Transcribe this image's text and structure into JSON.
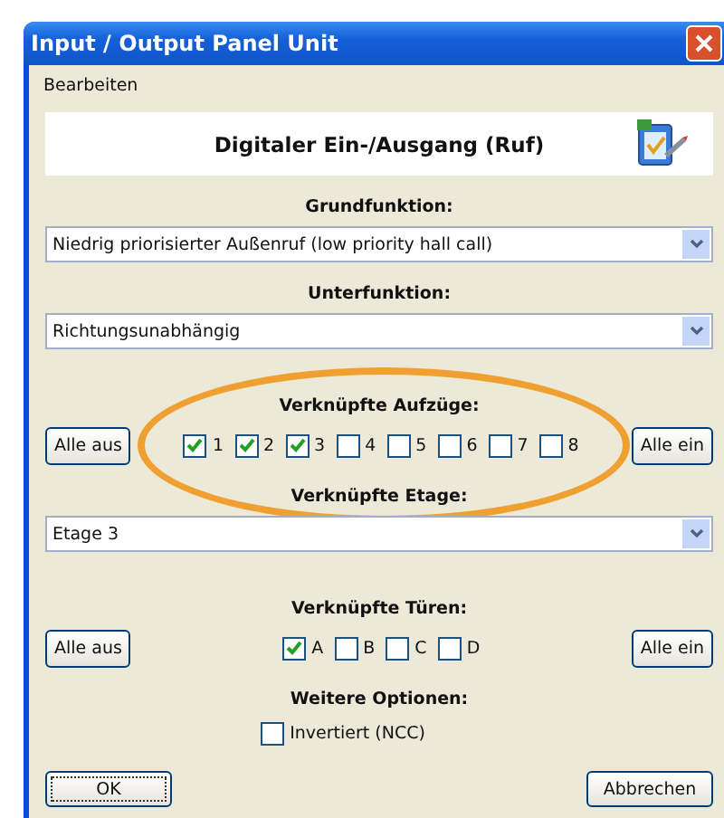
{
  "window": {
    "title": "Input / Output Panel Unit"
  },
  "menu": [
    "Bearbeiten"
  ],
  "header": {
    "title": "Digitaler Ein-/Ausgang (Ruf)"
  },
  "sections": [
    {
      "kind": "select",
      "label": "Grundfunktion:",
      "value": "Niedrig priorisierter Außenruf (low priority hall call)"
    },
    {
      "kind": "select",
      "label": "Unterfunktion:",
      "value": "Richtungsunabhängig"
    },
    {
      "kind": "checks",
      "label": "Verknüpfte Aufzüge:",
      "highlighted": true,
      "buttons": [
        "Alle aus",
        "Alle ein"
      ],
      "options": [
        {
          "label": "1",
          "checked": true
        },
        {
          "label": "2",
          "checked": true
        },
        {
          "label": "3",
          "checked": true
        },
        {
          "label": "4",
          "checked": false
        },
        {
          "label": "5",
          "checked": false
        },
        {
          "label": "6",
          "checked": false
        },
        {
          "label": "7",
          "checked": false
        },
        {
          "label": "8",
          "checked": false
        }
      ]
    },
    {
      "kind": "select",
      "label": "Verknüpfte Etage:",
      "value": "Etage 3"
    },
    {
      "kind": "checks",
      "label": "Verknüpfte Türen:",
      "buttons": [
        "Alle aus",
        "Alle ein"
      ],
      "options": [
        {
          "label": "A",
          "checked": true
        },
        {
          "label": "B",
          "checked": false
        },
        {
          "label": "C",
          "checked": false
        },
        {
          "label": "D",
          "checked": false
        }
      ]
    },
    {
      "kind": "options",
      "label": "Weitere Optionen:",
      "options": [
        {
          "label": "Invertiert (NCC)",
          "checked": false
        }
      ]
    }
  ],
  "buttons": [
    {
      "label": "OK",
      "focused": true
    },
    {
      "label": "Abbrechen",
      "focused": false
    }
  ]
}
